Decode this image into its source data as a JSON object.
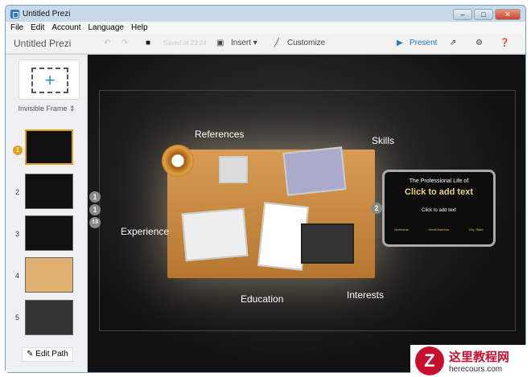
{
  "window": {
    "title": "Untitled Prezi"
  },
  "menu": [
    "File",
    "Edit",
    "Account",
    "Language",
    "Help"
  ],
  "toolbar": {
    "doc_title": "Untitled Prezi",
    "saved": "Saved at 23:24",
    "insert": "Insert",
    "customize": "Customize",
    "present": "Present"
  },
  "sidebar": {
    "frame_type": "Invisible Frame",
    "edit_path": "Edit Path",
    "thumbs": [
      "1",
      "2",
      "3",
      "4",
      "5"
    ]
  },
  "canvas": {
    "labels": {
      "references": "References",
      "skills": "Skills",
      "experience": "Experience",
      "education": "Education",
      "interests": "Interests"
    },
    "frame": {
      "subtitle": "The Professional Life of",
      "title": "Click to add text",
      "body": "Click to add text",
      "footer": [
        "Nickname",
        "Email Address",
        "City, State"
      ]
    },
    "path_markers": [
      "1",
      "1",
      "13",
      "2"
    ]
  },
  "colors": {
    "accent": "#2a78c9",
    "title_gold": "#f0d27a"
  },
  "watermark": {
    "brand": "这里教程网",
    "url": "herecours.com"
  }
}
